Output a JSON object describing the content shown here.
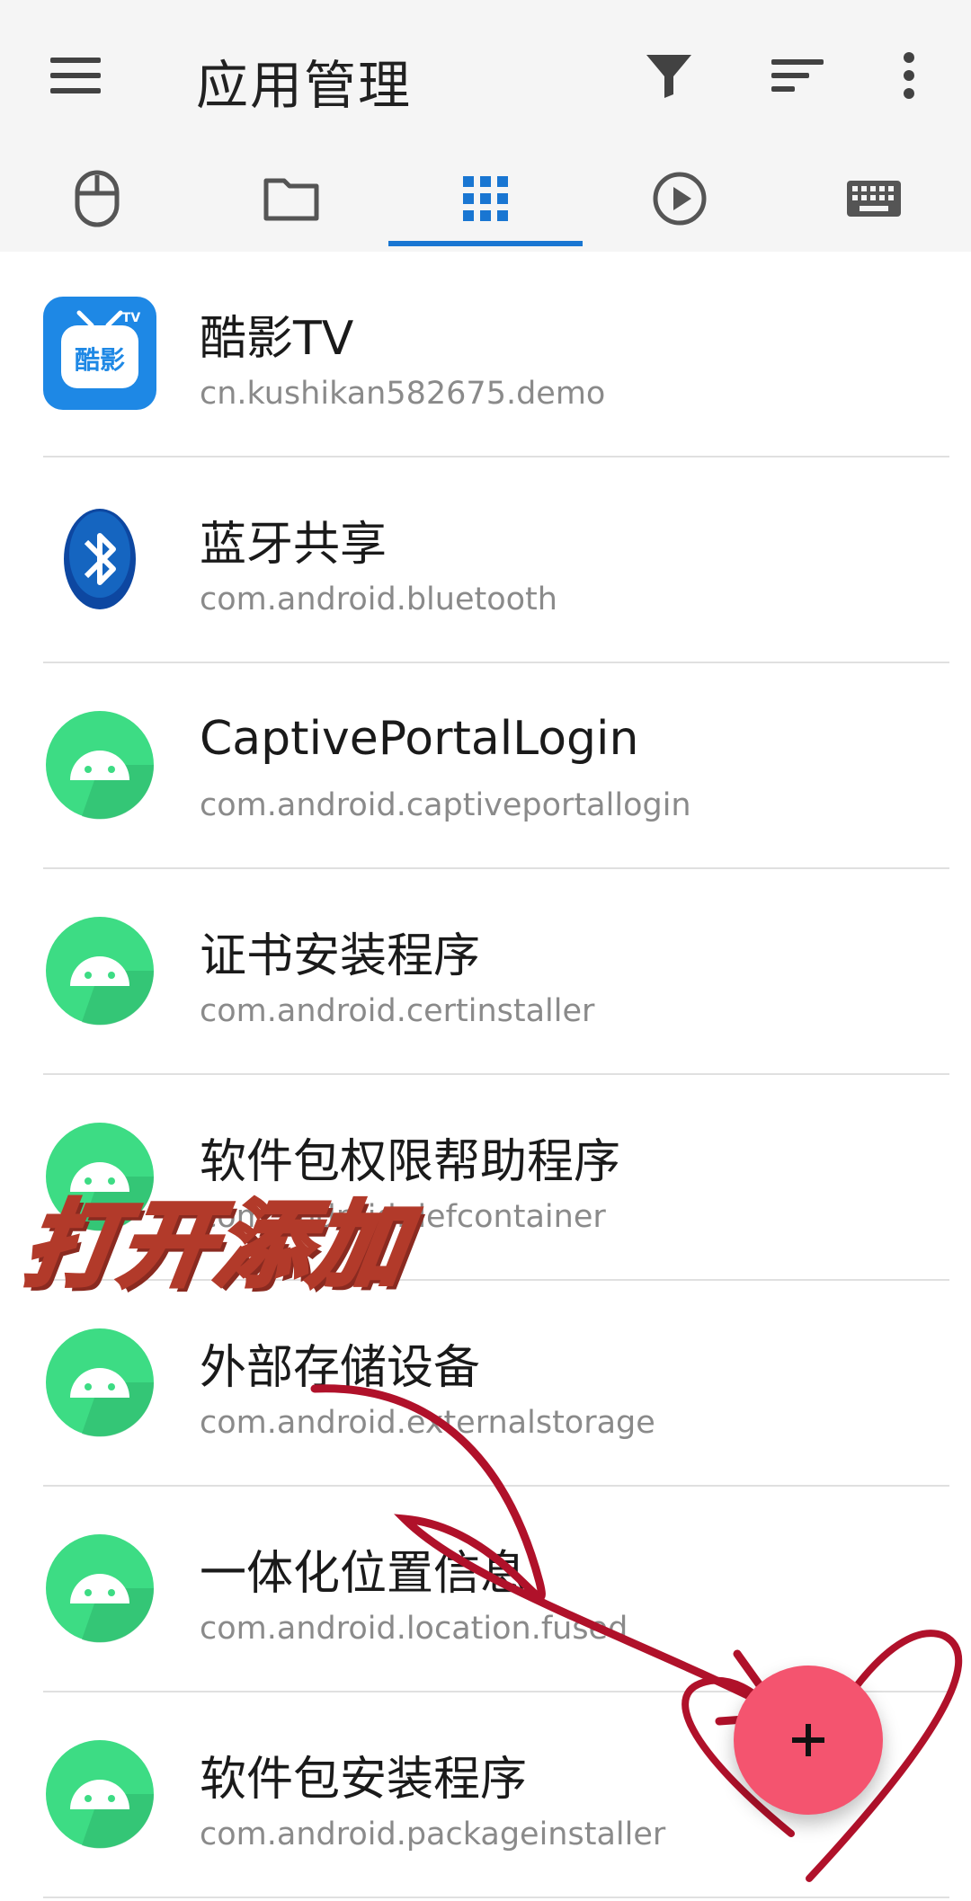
{
  "toolbar": {
    "title": "应用管理",
    "menu_icon": "menu-icon",
    "filter_icon": "filter-icon",
    "sort_icon": "sort-icon",
    "more_icon": "more-vert-icon"
  },
  "tabs": [
    {
      "icon": "mouse-icon",
      "selected": false
    },
    {
      "icon": "folder-icon",
      "selected": false
    },
    {
      "icon": "apps-grid-icon",
      "selected": true
    },
    {
      "icon": "play-circle-icon",
      "selected": false
    },
    {
      "icon": "keyboard-icon",
      "selected": false
    }
  ],
  "accent_color": "#1976d2",
  "apps": [
    {
      "name": "酷影TV",
      "package": "cn.kushikan582675.demo",
      "icon": "kuying-tv-icon",
      "icon_text": "酷影",
      "icon_badge": "TV"
    },
    {
      "name": "蓝牙共享",
      "package": "com.android.bluetooth",
      "icon": "bluetooth-icon"
    },
    {
      "name": "CaptivePortalLogin",
      "package": "com.android.captiveportallogin",
      "icon": "android-icon"
    },
    {
      "name": "证书安装程序",
      "package": "com.android.certinstaller",
      "icon": "android-icon"
    },
    {
      "name": "软件包权限帮助程序",
      "package": "com.android.defcontainer",
      "icon": "android-icon"
    },
    {
      "name": "外部存储设备",
      "package": "com.android.externalstorage",
      "icon": "android-icon"
    },
    {
      "name": "一体化位置信息",
      "package": "com.android.location.fused",
      "icon": "android-icon"
    },
    {
      "name": "软件包安装程序",
      "package": "com.android.packageinstaller",
      "icon": "android-icon"
    }
  ],
  "overlay": {
    "caption": "打开添加"
  },
  "fab": {
    "label": "+",
    "color": "#f4546f"
  }
}
